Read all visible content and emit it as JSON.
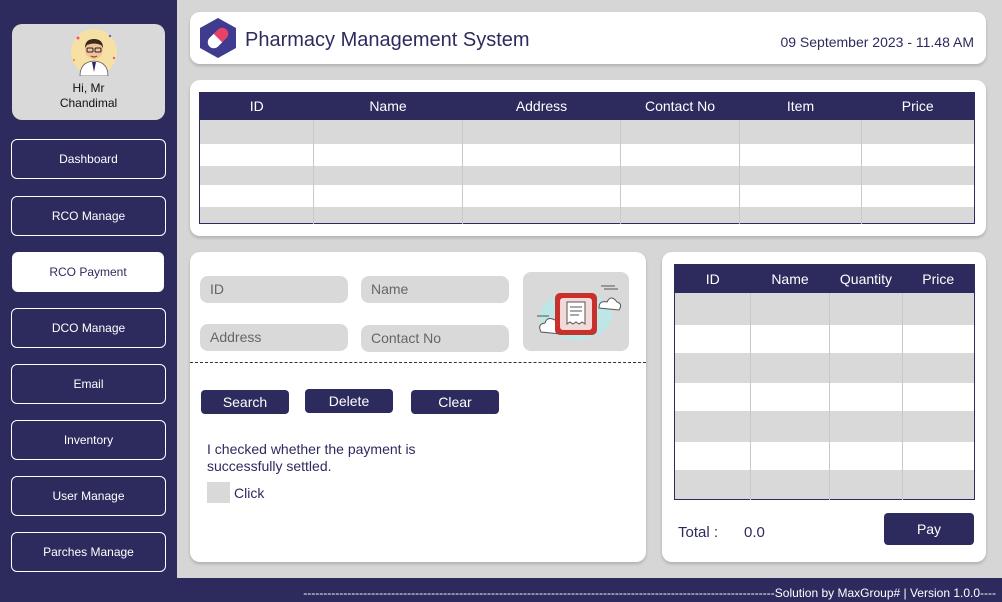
{
  "profile": {
    "greeting_line1": "Hi, Mr",
    "greeting_line2": "Chandimal"
  },
  "nav": {
    "dashboard": "Dashboard",
    "rco_manage": "RCO Manage",
    "rco_payment": "RCO Payment",
    "dco_manage": "DCO Manage",
    "email": "Email",
    "inventory": "Inventory",
    "user_manage": "User Manage",
    "parches_manage": "Parches Manage"
  },
  "header": {
    "title": "Pharmacy Management System",
    "datetime": "09 September 2023 - 11.48 AM"
  },
  "orders_table": {
    "columns": [
      "ID",
      "Name",
      "Address",
      "Contact No",
      "Item",
      "Price"
    ]
  },
  "form": {
    "id_placeholder": "ID",
    "name_placeholder": "Name",
    "address_placeholder": "Address",
    "contact_placeholder": "Contact No",
    "search_label": "Search",
    "delete_label": "Delete",
    "clear_label": "Clear",
    "confirm_text": "I checked whether the payment is successfully settled.",
    "checkbox_label": "Click"
  },
  "cart_table": {
    "columns": [
      "ID",
      "Name",
      "Quantity",
      "Price"
    ]
  },
  "cart": {
    "total_label": "Total :",
    "total_value": "0.0",
    "pay_label": "Pay"
  },
  "footer": {
    "text": "----------------------------------------------------------------------------------------------------------------------Solution by MaxGroup# | Version 1.0.0----"
  },
  "colors": {
    "primary": "#2d2b5e",
    "panel": "#d9d9d9",
    "background": "#d6d6d6"
  },
  "icons": [
    "user-avatar",
    "pill-logo",
    "receipt-icon"
  ]
}
